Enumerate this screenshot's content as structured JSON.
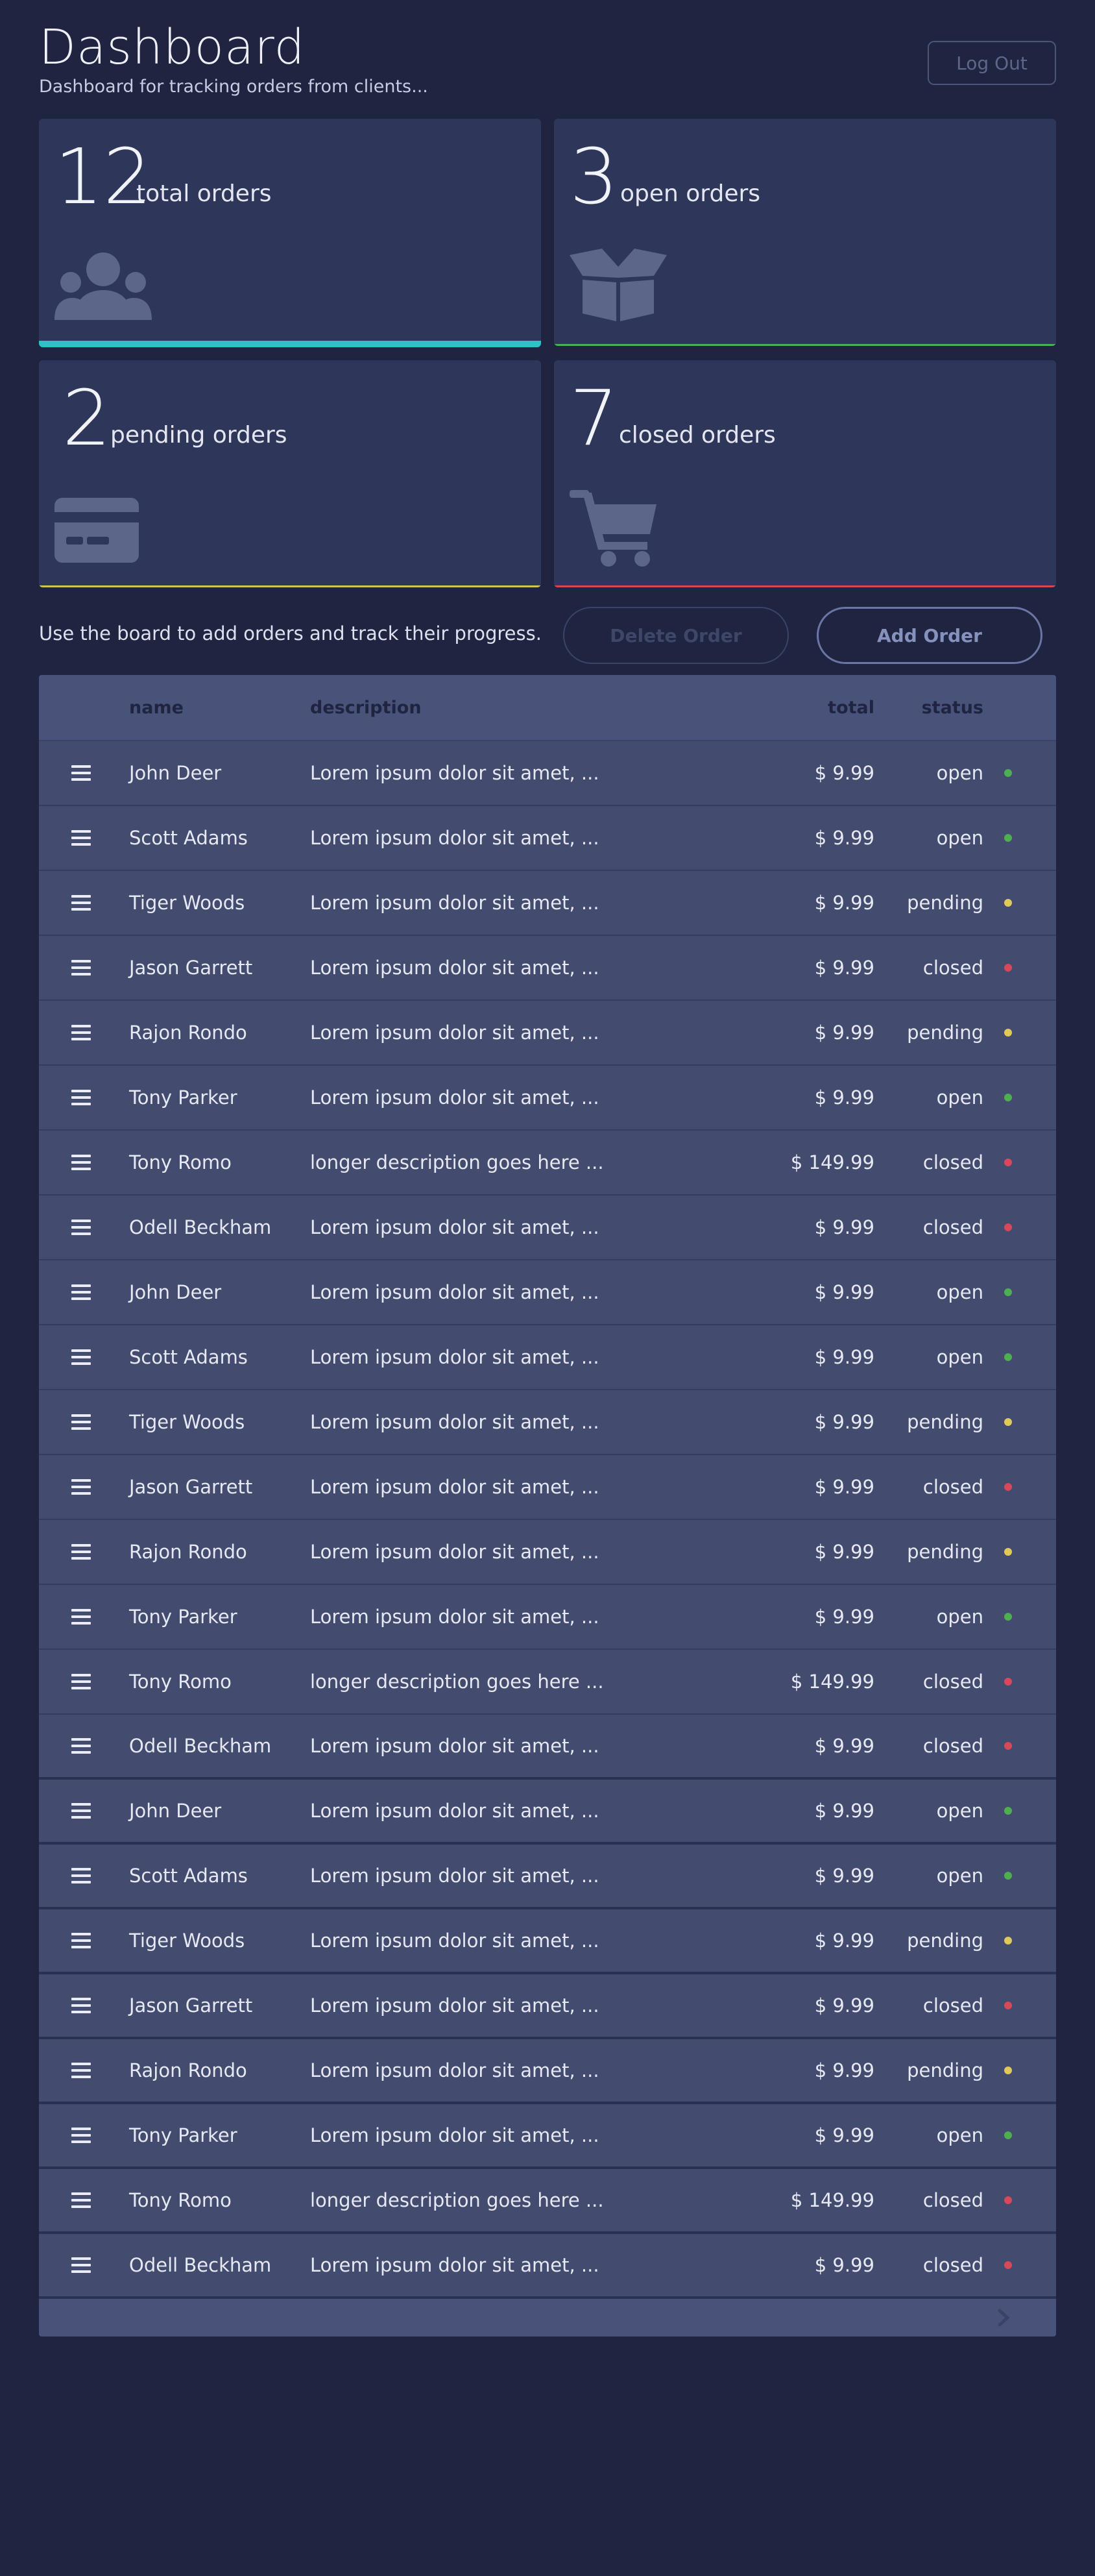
{
  "header": {
    "title": "Dashboard",
    "subtitle": "Dashboard for tracking orders from clients...",
    "logout_label": "Log Out"
  },
  "cards": [
    {
      "count": "12",
      "label": "total orders",
      "icon": "users-icon",
      "accent": "#2bc4c6"
    },
    {
      "count": "3",
      "label": "open orders",
      "icon": "open-box-icon",
      "accent": "#4fae5a"
    },
    {
      "count": "2",
      "label": "pending orders",
      "icon": "credit-card-icon",
      "accent": "#d6c25a"
    },
    {
      "count": "7",
      "label": "closed orders",
      "icon": "shopping-cart-icon",
      "accent": "#cf4a55"
    }
  ],
  "actions": {
    "help_text": "Use the board to add orders and track their progress.",
    "delete_label": "Delete Order",
    "add_label": "Add Order"
  },
  "table": {
    "columns": {
      "name": "name",
      "description": "description",
      "total": "total",
      "status": "status"
    },
    "status_colors": {
      "open": "#4caf50",
      "pending": "#e0c85a",
      "closed": "#d9485a"
    },
    "rows": [
      {
        "name": "John Deer",
        "description": "Lorem ipsum dolor sit amet, ...",
        "total": "$ 9.99",
        "status": "open"
      },
      {
        "name": "Scott Adams",
        "description": "Lorem ipsum dolor sit amet, ...",
        "total": "$ 9.99",
        "status": "open"
      },
      {
        "name": "Tiger Woods",
        "description": "Lorem ipsum dolor sit amet, ...",
        "total": "$ 9.99",
        "status": "pending"
      },
      {
        "name": "Jason Garrett",
        "description": "Lorem ipsum dolor sit amet, ...",
        "total": "$ 9.99",
        "status": "closed"
      },
      {
        "name": "Rajon Rondo",
        "description": "Lorem ipsum dolor sit amet, ...",
        "total": "$ 9.99",
        "status": "pending"
      },
      {
        "name": "Tony Parker",
        "description": "Lorem ipsum dolor sit amet, ...",
        "total": "$ 9.99",
        "status": "open"
      },
      {
        "name": "Tony Romo",
        "description": "longer description goes here ...",
        "total": "$ 149.99",
        "status": "closed"
      },
      {
        "name": "Odell Beckham",
        "description": "Lorem ipsum dolor sit amet, ...",
        "total": "$ 9.99",
        "status": "closed"
      },
      {
        "name": "John Deer",
        "description": "Lorem ipsum dolor sit amet, ...",
        "total": "$ 9.99",
        "status": "open"
      },
      {
        "name": "Scott Adams",
        "description": "Lorem ipsum dolor sit amet, ...",
        "total": "$ 9.99",
        "status": "open"
      },
      {
        "name": "Tiger Woods",
        "description": "Lorem ipsum dolor sit amet, ...",
        "total": "$ 9.99",
        "status": "pending"
      },
      {
        "name": "Jason Garrett",
        "description": "Lorem ipsum dolor sit amet, ...",
        "total": "$ 9.99",
        "status": "closed"
      },
      {
        "name": "Rajon Rondo",
        "description": "Lorem ipsum dolor sit amet, ...",
        "total": "$ 9.99",
        "status": "pending"
      },
      {
        "name": "Tony Parker",
        "description": "Lorem ipsum dolor sit amet, ...",
        "total": "$ 9.99",
        "status": "open"
      },
      {
        "name": "Tony Romo",
        "description": "longer description goes here ...",
        "total": "$ 149.99",
        "status": "closed"
      },
      {
        "name": "Odell Beckham",
        "description": "Lorem ipsum dolor sit amet, ...",
        "total": "$ 9.99",
        "status": "closed"
      },
      {
        "name": "John Deer",
        "description": "Lorem ipsum dolor sit amet, ...",
        "total": "$ 9.99",
        "status": "open"
      },
      {
        "name": "Scott Adams",
        "description": "Lorem ipsum dolor sit amet, ...",
        "total": "$ 9.99",
        "status": "open"
      },
      {
        "name": "Tiger Woods",
        "description": "Lorem ipsum dolor sit amet, ...",
        "total": "$ 9.99",
        "status": "pending"
      },
      {
        "name": "Jason Garrett",
        "description": "Lorem ipsum dolor sit amet, ...",
        "total": "$ 9.99",
        "status": "closed"
      },
      {
        "name": "Rajon Rondo",
        "description": "Lorem ipsum dolor sit amet, ...",
        "total": "$ 9.99",
        "status": "pending"
      },
      {
        "name": "Tony Parker",
        "description": "Lorem ipsum dolor sit amet, ...",
        "total": "$ 9.99",
        "status": "open"
      },
      {
        "name": "Tony Romo",
        "description": "longer description goes here ...",
        "total": "$ 149.99",
        "status": "closed"
      },
      {
        "name": "Odell Beckham",
        "description": "Lorem ipsum dolor sit amet, ...",
        "total": "$ 9.99",
        "status": "closed"
      }
    ],
    "footer": {
      "next_icon": "chevron-right-icon"
    }
  }
}
